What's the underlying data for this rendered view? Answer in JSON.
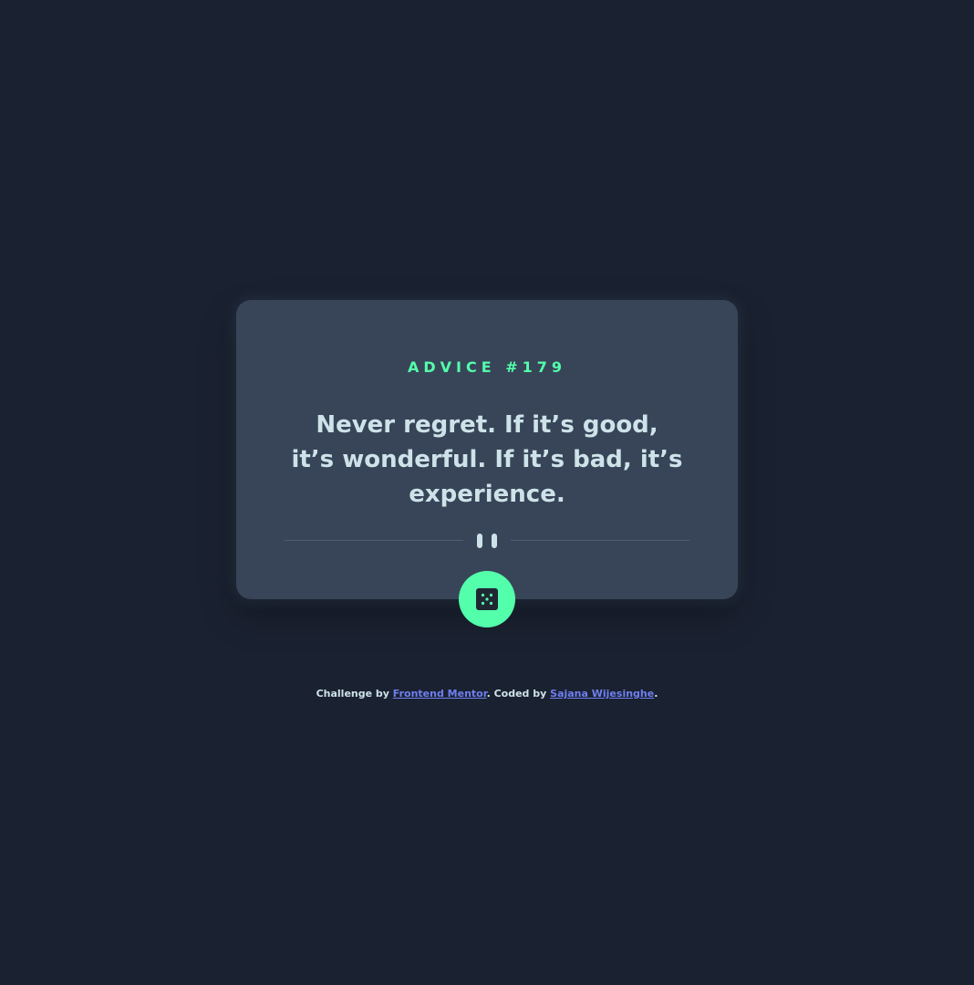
{
  "advice": {
    "label": "ADVICE #179",
    "quote": "Never regret. If it’s good, it’s wonderful. If it’s bad, it’s experience."
  },
  "divider": {
    "icon": "pause-icon"
  },
  "dice_button": {
    "icon": "dice-icon"
  },
  "footer": {
    "prefix": "Challenge by ",
    "challenge_link": "Frontend Mentor",
    "middle": ". Coded by ",
    "author_link": "Sajana Wijesinghe",
    "suffix": "."
  },
  "colors": {
    "background": "#1a2130",
    "card": "#384558",
    "accent": "#53ffab",
    "text": "#cee3e9",
    "link": "#6f7ff0"
  }
}
